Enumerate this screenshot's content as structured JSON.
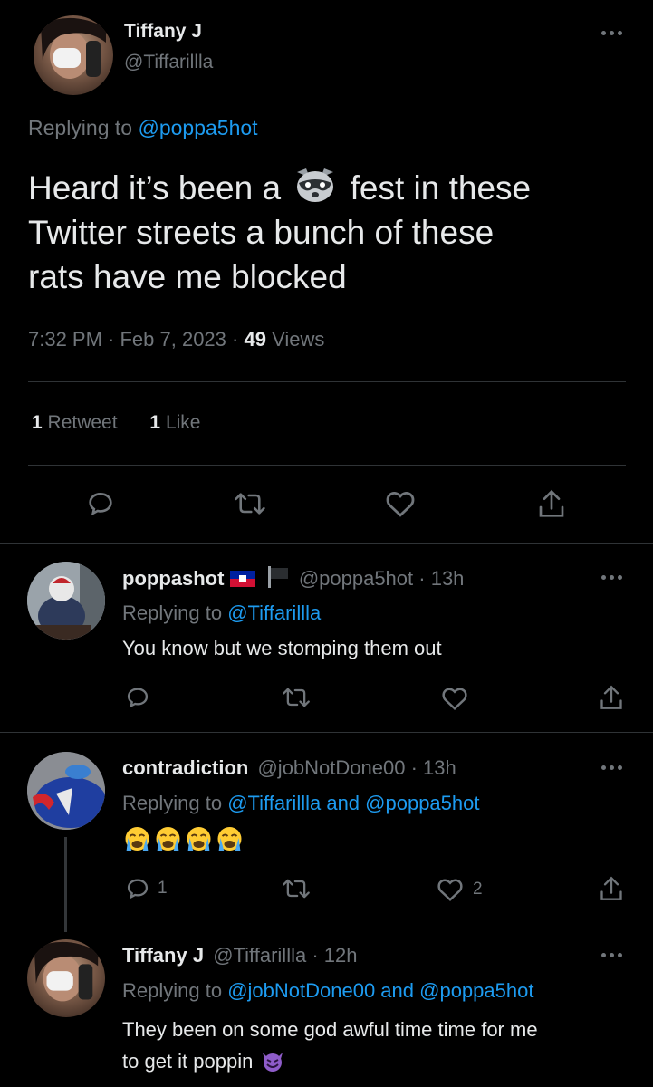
{
  "main_tweet": {
    "author_name": "Tiffany J",
    "author_handle": "@Tiffarillla",
    "replying_prefix": "Replying to",
    "replying_to": "@poppa5hot",
    "text_part1": "Heard it’s been a",
    "text_part2": "fest in these",
    "text_line2": "Twitter streets a bunch of these",
    "text_line3": "rats have me blocked",
    "time": "7:32 PM · Feb 7, 2023 ·",
    "views_count": "49",
    "views_label": "Views",
    "retweet_count": "1",
    "retweet_label": "Retweet",
    "like_count": "1",
    "like_label": "Like"
  },
  "replies": [
    {
      "author_name": "poppashot",
      "author_handle": "@poppa5hot",
      "time": "· 13h",
      "replying_prefix": "Replying to",
      "replying_to": "@Tiffarillla",
      "text": "You know but we stomping them out"
    },
    {
      "author_name": "contradiction",
      "author_handle": "@jobNotDone00",
      "time": "· 13h",
      "replying_prefix": "Replying to",
      "replying_to": "@Tiffarillla and @poppa5hot",
      "reply_count": "1",
      "like_count": "2"
    },
    {
      "author_name": "Tiffany J",
      "author_handle": "@Tiffarillla",
      "time": "· 12h",
      "replying_prefix": "Replying to",
      "replying_to": "@jobNotDone00 and @poppa5hot",
      "text_line1": "They been on some god awful time time for me",
      "text_line2": "to get it poppin"
    }
  ],
  "icons": {
    "reply": "speech-bubble-icon",
    "retweet": "retweet-icon",
    "like": "heart-icon",
    "share": "share-icon",
    "more": "more-dots-icon"
  },
  "colors": {
    "background": "#000000",
    "text": "#e7e9ea",
    "muted": "#71767b",
    "link": "#1d9bf0",
    "divider": "#2f3336"
  }
}
